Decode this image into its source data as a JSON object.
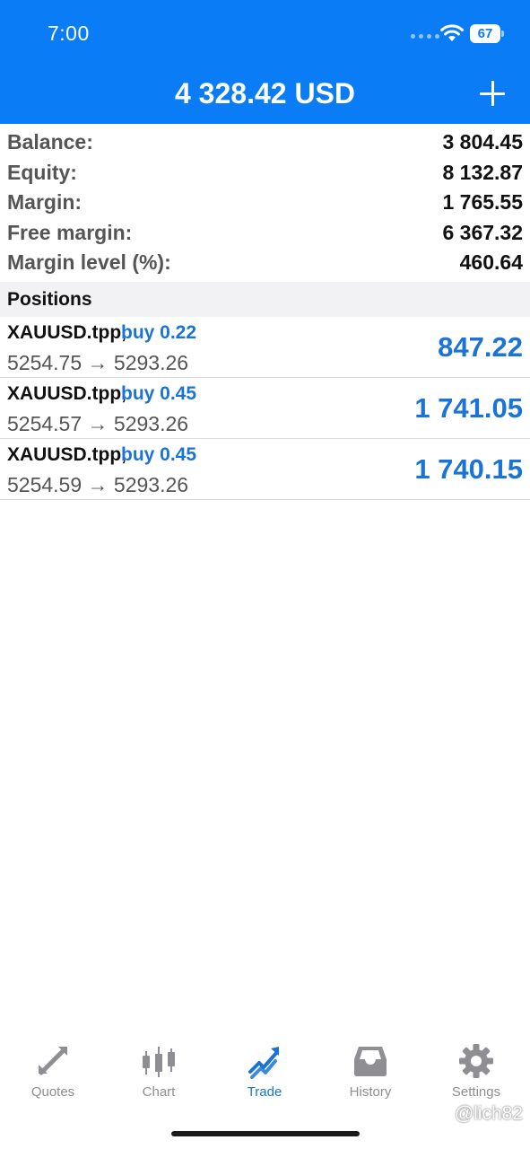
{
  "status_bar": {
    "time": "7:00",
    "battery": "67"
  },
  "header": {
    "title": "4 328.42 USD"
  },
  "summary": [
    {
      "label": "Balance:",
      "value": "3 804.45"
    },
    {
      "label": "Equity:",
      "value": "8 132.87"
    },
    {
      "label": "Margin:",
      "value": "1 765.55"
    },
    {
      "label": "Free margin:",
      "value": "6 367.32"
    },
    {
      "label": "Margin level (%):",
      "value": "460.64"
    }
  ],
  "positions": {
    "title": "Positions",
    "items": [
      {
        "symbol": "XAUUSD.tpp,",
        "type": "buy 0.22",
        "prices": "5254.75 → 5293.26",
        "profit": "847.22"
      },
      {
        "symbol": "XAUUSD.tpp,",
        "type": "buy 0.45",
        "prices": "5254.57 → 5293.26",
        "profit": "1 741.05"
      },
      {
        "symbol": "XAUUSD.tpp,",
        "type": "buy 0.45",
        "prices": "5254.59 → 5293.26",
        "profit": "1 740.15"
      }
    ]
  },
  "tabs": [
    {
      "label": "Quotes",
      "icon": "quotes-icon",
      "active": false
    },
    {
      "label": "Chart",
      "icon": "chart-icon",
      "active": false
    },
    {
      "label": "Trade",
      "icon": "trade-icon",
      "active": true
    },
    {
      "label": "History",
      "icon": "history-icon",
      "active": false
    },
    {
      "label": "Settings",
      "icon": "settings-icon",
      "active": false
    }
  ],
  "watermark": "@lich82",
  "colors": {
    "header_bg": "#0a7cf5",
    "accent": "#1a74d6",
    "inactive": "#8e8e93"
  }
}
